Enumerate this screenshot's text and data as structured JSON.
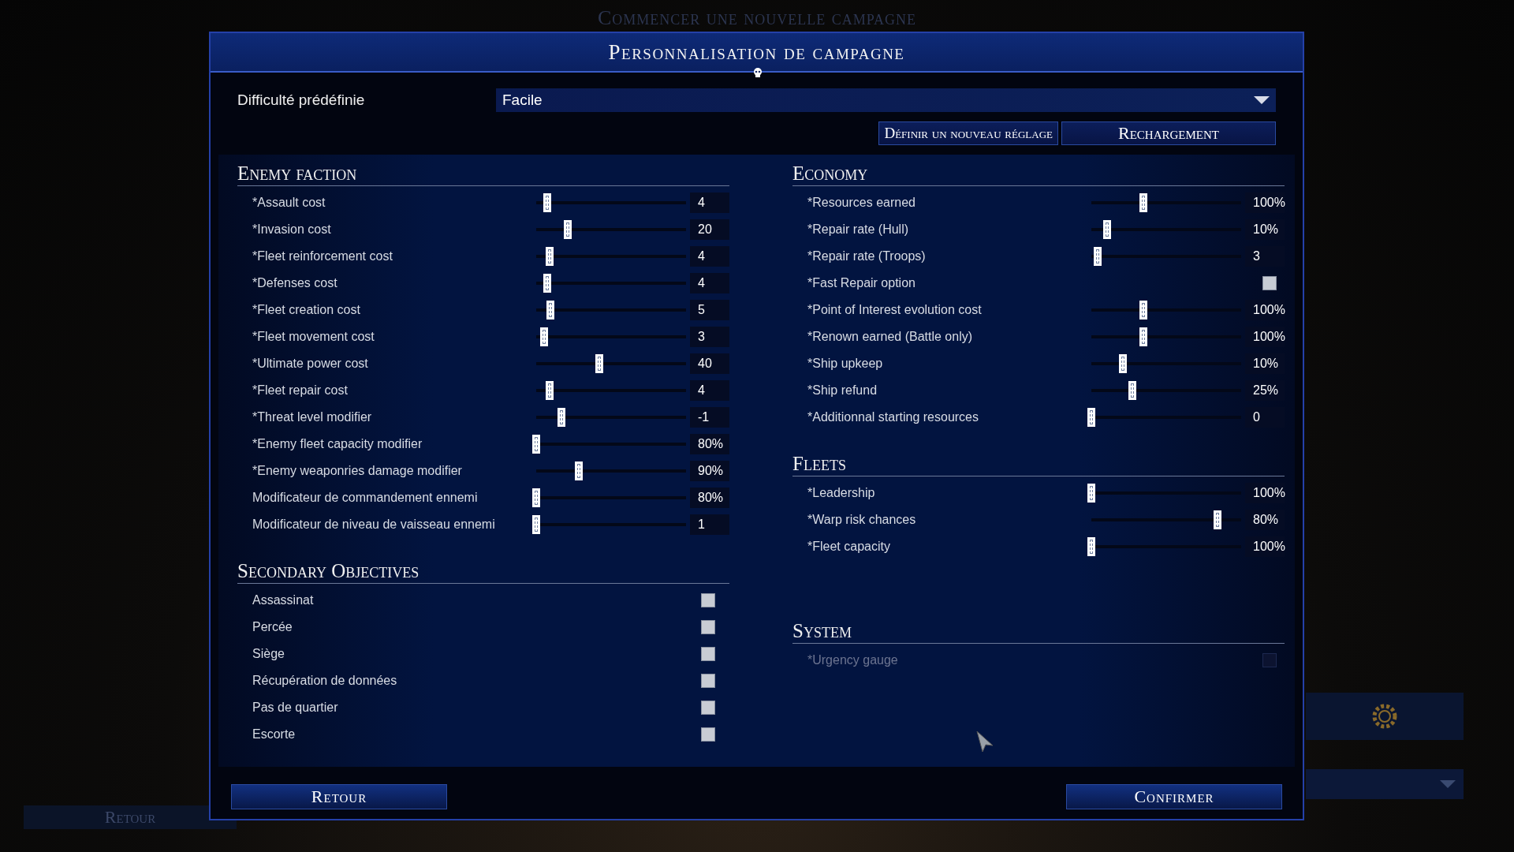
{
  "background": {
    "title": "Commencer une nouvelle campagne",
    "back_button": "Retour"
  },
  "dialog": {
    "title": "Personnalisation de campagne",
    "preset": {
      "label": "Difficulté prédéfinie",
      "value": "Facile"
    },
    "buttons": [
      "Définir un nouveau réglage",
      "Rechargement"
    ]
  },
  "columns": [
    [
      {
        "title": "Enemy faction",
        "rows": [
          {
            "kind": "slider",
            "label": "*Assault cost",
            "level": 0.07,
            "value": "4"
          },
          {
            "kind": "slider",
            "label": "*Invasion cost",
            "level": 0.2,
            "value": "20"
          },
          {
            "kind": "slider",
            "label": "*Fleet reinforcement cost",
            "level": 0.085,
            "value": "4"
          },
          {
            "kind": "slider",
            "label": "*Defenses cost",
            "level": 0.07,
            "value": "4"
          },
          {
            "kind": "slider",
            "label": "*Fleet creation cost",
            "level": 0.09,
            "value": "5"
          },
          {
            "kind": "slider",
            "label": "*Fleet movement cost",
            "level": 0.05,
            "value": "3"
          },
          {
            "kind": "slider",
            "label": "*Ultimate power cost",
            "level": 0.4,
            "value": "40"
          },
          {
            "kind": "slider",
            "label": "*Fleet repair cost",
            "level": 0.085,
            "value": "4"
          },
          {
            "kind": "slider",
            "label": "*Threat level modifier",
            "level": 0.16,
            "value": "-1"
          },
          {
            "kind": "slider",
            "label": "*Enemy fleet capacity modifier",
            "level": 0.0,
            "value": "80%"
          },
          {
            "kind": "slider",
            "label": "*Enemy weaponries damage modifier",
            "level": 0.27,
            "value": "90%"
          },
          {
            "kind": "slider",
            "label": "Modificateur de commandement ennemi",
            "level": 0.0,
            "value": "80%"
          },
          {
            "kind": "slider",
            "label": "Modificateur de niveau de vaisseau ennemi",
            "level": 0.0,
            "value": "1"
          }
        ]
      },
      {
        "title": "Secondary Objectives",
        "rows": [
          {
            "kind": "checkbox",
            "label": "Assassinat",
            "checked": false,
            "disabled": false
          },
          {
            "kind": "checkbox",
            "label": "Percée",
            "checked": false,
            "disabled": false
          },
          {
            "kind": "checkbox",
            "label": "Siège",
            "checked": false,
            "disabled": false
          },
          {
            "kind": "checkbox",
            "label": "Récupération de données",
            "checked": false,
            "disabled": false
          },
          {
            "kind": "checkbox",
            "label": "Pas de quartier",
            "checked": false,
            "disabled": false
          },
          {
            "kind": "checkbox",
            "label": "Escorte",
            "checked": false,
            "disabled": false
          }
        ]
      }
    ],
    [
      {
        "title": "Economy",
        "rows": [
          {
            "kind": "slider",
            "label": "*Resources earned",
            "level": 0.33,
            "value": "100%"
          },
          {
            "kind": "slider",
            "label": "*Repair rate (Hull)",
            "level": 0.1,
            "value": "10%"
          },
          {
            "kind": "slider",
            "label": "*Repair rate (Troops)",
            "level": 0.04,
            "value": "3"
          },
          {
            "kind": "checkbox",
            "label": "*Fast Repair option",
            "checked": false,
            "disabled": false
          },
          {
            "kind": "slider",
            "label": "*Point of Interest evolution cost",
            "level": 0.33,
            "value": "100%"
          },
          {
            "kind": "slider",
            "label": "*Renown earned (Battle only)",
            "level": 0.33,
            "value": "100%"
          },
          {
            "kind": "slider",
            "label": "*Ship upkeep",
            "level": 0.2,
            "value": "10%"
          },
          {
            "kind": "slider",
            "label": "*Ship refund",
            "level": 0.26,
            "value": "25%"
          },
          {
            "kind": "slider",
            "label": "*Additionnal starting resources",
            "level": 0.0,
            "value": "0"
          }
        ]
      },
      {
        "title": "Fleets",
        "rows": [
          {
            "kind": "slider",
            "label": "*Leadership",
            "level": 0.0,
            "value": "100%"
          },
          {
            "kind": "slider",
            "label": "*Warp risk chances",
            "level": 0.8,
            "value": "80%"
          },
          {
            "kind": "slider",
            "label": "*Fleet capacity",
            "level": 0.0,
            "value": "100%"
          }
        ]
      },
      {
        "title": "System",
        "rows": [
          {
            "kind": "checkbox",
            "label": "*Urgency gauge",
            "checked": false,
            "disabled": true
          }
        ]
      }
    ]
  ],
  "footer": {
    "back": "Retour",
    "confirm": "Confirmer"
  }
}
